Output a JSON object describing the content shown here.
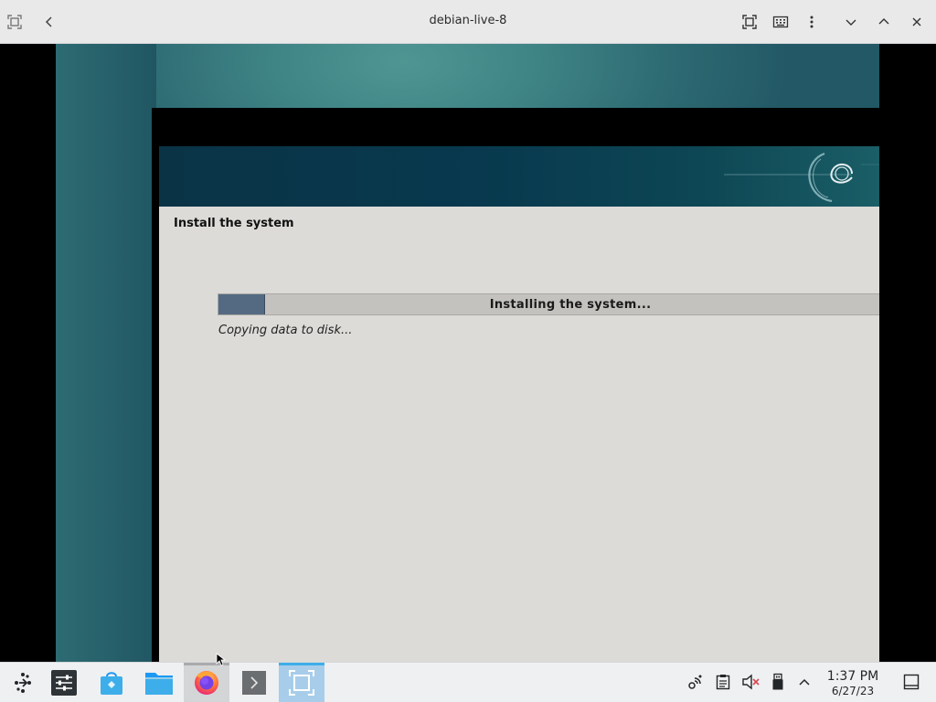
{
  "window": {
    "title": "debian-live-8",
    "buttons": [
      "back-icon",
      "fullscreen-icon",
      "keyboard-icon",
      "more-icon",
      "minimize-icon",
      "maximize-icon",
      "close-icon"
    ]
  },
  "installer": {
    "section_title": "Install the system",
    "progress": {
      "label": "Installing the system...",
      "fraction": 0.07
    },
    "status_text": "Copying data to disk..."
  },
  "taskbar": {
    "launcher_icon": "application-launcher-icon",
    "tasks": [
      {
        "name": "settings-icon",
        "state": "normal"
      },
      {
        "name": "discover-store-icon",
        "state": "normal"
      },
      {
        "name": "file-manager-icon",
        "state": "normal"
      },
      {
        "name": "firefox-icon",
        "state": "active"
      },
      {
        "name": "terminal-icon",
        "state": "normal"
      },
      {
        "name": "remote-viewer-icon",
        "state": "focused"
      }
    ],
    "tray": [
      "network-icon",
      "clipboard-icon",
      "volume-muted-icon",
      "usb-device-icon",
      "expand-tray-icon"
    ],
    "clock": {
      "time": "1:37 PM",
      "date": "6/27/23"
    },
    "show_desktop_icon": "show-desktop-icon"
  },
  "colors": {
    "titlebar": "#e9e9ea",
    "installer_bg": "#dcdbd8",
    "progress_fill": "#546a82",
    "banner": "#08394e",
    "taskbar": "#eff0f1",
    "focused_task": "#a7cdea"
  }
}
